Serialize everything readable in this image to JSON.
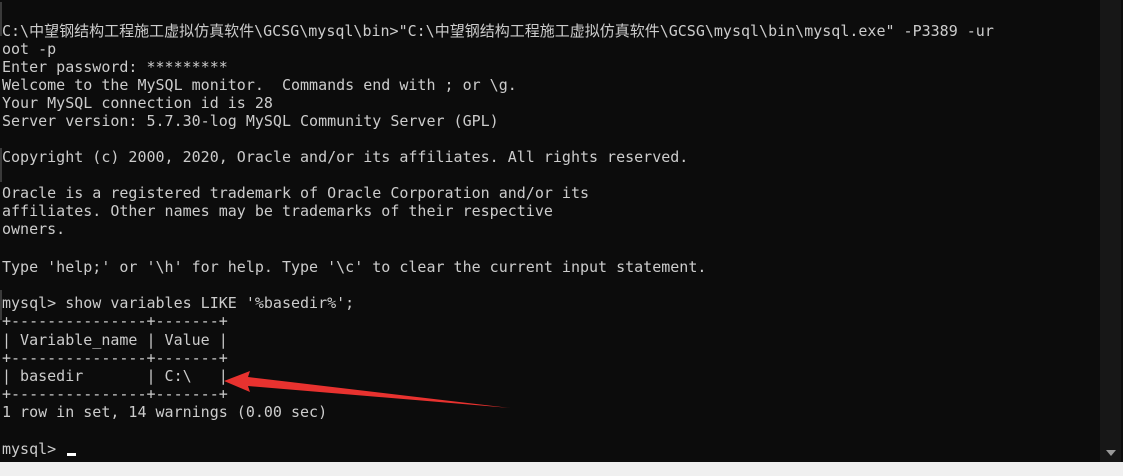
{
  "terminal": {
    "lines": [
      "C:\\中望钢结构工程施工虚拟仿真软件\\GCSG\\mysql\\bin>\"C:\\中望钢结构工程施工虚拟仿真软件\\GCSG\\mysql\\bin\\mysql.exe\" -P3389 -ur",
      "oot -p",
      "Enter password: *********",
      "Welcome to the MySQL monitor.  Commands end with ; or \\g.",
      "Your MySQL connection id is 28",
      "Server version: 5.7.30-log MySQL Community Server (GPL)",
      "",
      "Copyright (c) 2000, 2020, Oracle and/or its affiliates. All rights reserved.",
      "",
      "Oracle is a registered trademark of Oracle Corporation and/or its",
      "affiliates. Other names may be trademarks of their respective",
      "owners.",
      "",
      "Type 'help;' or '\\h' for help. Type '\\c' to clear the current input statement.",
      "",
      "mysql> show variables LIKE '%basedir%';",
      "+---------------+-------+",
      "| Variable_name | Value |",
      "+---------------+-------+",
      "| basedir       | C:\\   |",
      "+---------------+-------+",
      "1 row in set, 14 warnings (0.00 sec)",
      "",
      "mysql> "
    ]
  },
  "colors": {
    "background": "#0c0c0c",
    "text": "#cccccc",
    "annotation_arrow": "#e8322f"
  },
  "annotation": {
    "icon": "red-arrow-icon"
  }
}
